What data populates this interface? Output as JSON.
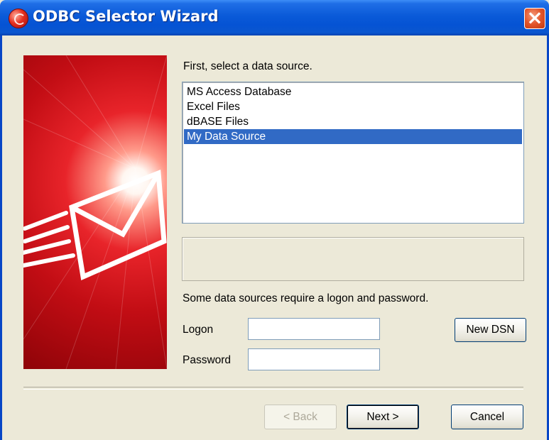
{
  "window": {
    "title": "ODBC Selector Wizard"
  },
  "main": {
    "instruction": "First, select a data source.",
    "data_sources": [
      {
        "label": "MS Access Database",
        "selected": false
      },
      {
        "label": "Excel Files",
        "selected": false
      },
      {
        "label": "dBASE Files",
        "selected": false
      },
      {
        "label": "My Data Source",
        "selected": true
      }
    ],
    "info_text": "",
    "logon_note": "Some data sources require a logon and password.",
    "logon_label": "Logon",
    "logon_value": "",
    "password_label": "Password",
    "password_value": ""
  },
  "buttons": {
    "new_dsn": "New DSN",
    "back": "< Back",
    "next": "Next >",
    "cancel": "Cancel"
  },
  "colors": {
    "title_bar": "#0553d4",
    "selection": "#316ac5",
    "banner_red": "#c20d14",
    "close_button": "#e2542a"
  },
  "icons": {
    "title": "odbc-app-icon",
    "close": "close-icon",
    "banner": "email-envelope-graphic"
  }
}
